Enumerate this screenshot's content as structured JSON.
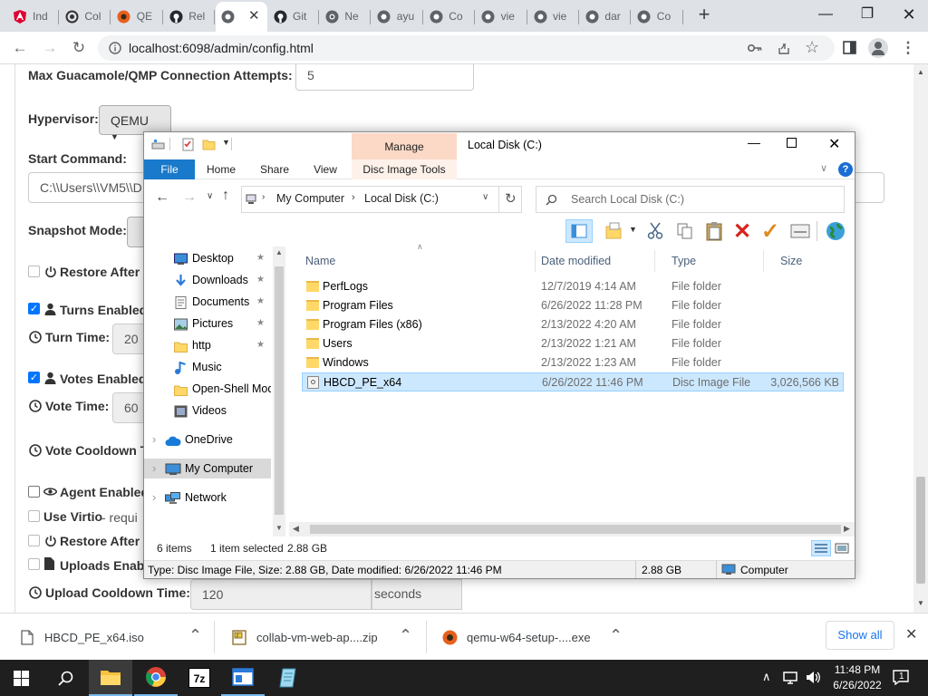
{
  "browser": {
    "tabs": [
      {
        "label": "Ind",
        "icon": "angular-icon",
        "color": "#dd0031"
      },
      {
        "label": "Col",
        "icon": "collabvm-icon",
        "color": "#333333"
      },
      {
        "label": "QE",
        "icon": "qemu-icon",
        "color": "#e8601c"
      },
      {
        "label": "Rel",
        "icon": "github-icon",
        "color": "#24292e"
      },
      {
        "label": "",
        "icon": "globe-icon",
        "color": "#5f6368",
        "active": true
      },
      {
        "label": "Git",
        "icon": "github-icon",
        "color": "#24292e"
      },
      {
        "label": "Ne",
        "icon": "chrome-icon",
        "color": "#5f6368"
      },
      {
        "label": "ayu",
        "icon": "globe-icon",
        "color": "#5f6368"
      },
      {
        "label": "Co",
        "icon": "globe-icon",
        "color": "#5f6368"
      },
      {
        "label": "vie",
        "icon": "globe-icon",
        "color": "#5f6368"
      },
      {
        "label": "vie",
        "icon": "globe-icon",
        "color": "#5f6368"
      },
      {
        "label": "dar",
        "icon": "globe-icon",
        "color": "#5f6368"
      },
      {
        "label": "Co",
        "icon": "globe-icon",
        "color": "#5f6368"
      }
    ],
    "url": "localhost:6098/admin/config.html"
  },
  "config": {
    "max_attempts_label": "Max Guacamole/QMP Connection Attempts:",
    "max_attempts_value": "5",
    "hypervisor_label": "Hypervisor:",
    "hypervisor_value": "QEMU",
    "start_command_label": "Start Command:",
    "start_command_value": "C:\\\\Users\\\\VM5\\\\D",
    "snapshot_label": "Snapshot Mode:",
    "restore_after_label": "Restore After",
    "turns_label": "Turns Enabled",
    "turn_time_label": "Turn Time:",
    "turn_time_value": "20",
    "votes_label": "Votes Enabled",
    "vote_time_label": "Vote Time:",
    "vote_time_value": "60",
    "vote_cooldown_label": "Vote Cooldown T",
    "agent_label": "Agent Enabled",
    "virtio_label": "Use Virtio",
    "virtio_note": " - requi",
    "restore_after2_label": "Restore After",
    "uploads_label": "Uploads Enab",
    "upload_cooldown_label": "Upload Cooldown Time:",
    "upload_cooldown_value": "120",
    "upload_cooldown_unit": "seconds"
  },
  "explorer": {
    "title": "Local Disk (C:)",
    "manage_tab": "Manage",
    "ribbon": {
      "file": "File",
      "home": "Home",
      "share": "Share",
      "view": "View",
      "disc_tools": "Disc Image Tools"
    },
    "breadcrumb": [
      "My Computer",
      "Local Disk (C:)"
    ],
    "search_placeholder": "Search Local Disk (C:)",
    "nav": [
      {
        "label": "Desktop",
        "icon": "desktop-icon",
        "pinned": true
      },
      {
        "label": "Downloads",
        "icon": "downloads-icon",
        "pinned": true
      },
      {
        "label": "Documents",
        "icon": "documents-icon",
        "pinned": true
      },
      {
        "label": "Pictures",
        "icon": "pictures-icon",
        "pinned": true
      },
      {
        "label": "http",
        "icon": "folder-icon",
        "pinned": true
      },
      {
        "label": "Music",
        "icon": "music-icon",
        "pinned": false
      },
      {
        "label": "Open-Shell Mod",
        "icon": "folder-icon",
        "pinned": false
      },
      {
        "label": "Videos",
        "icon": "videos-icon",
        "pinned": false
      },
      {
        "label": "OneDrive",
        "icon": "onedrive-icon",
        "pinned": false
      },
      {
        "label": "My Computer",
        "icon": "computer-icon",
        "pinned": false,
        "selected": true
      },
      {
        "label": "Network",
        "icon": "network-icon",
        "pinned": false
      }
    ],
    "columns": {
      "name": "Name",
      "date": "Date modified",
      "type": "Type",
      "size": "Size"
    },
    "files": [
      {
        "name": "PerfLogs",
        "date": "12/7/2019 4:14 AM",
        "type": "File folder",
        "size": ""
      },
      {
        "name": "Program Files",
        "date": "6/26/2022 11:28 PM",
        "type": "File folder",
        "size": ""
      },
      {
        "name": "Program Files (x86)",
        "date": "2/13/2022 4:20 AM",
        "type": "File folder",
        "size": ""
      },
      {
        "name": "Users",
        "date": "2/13/2022 1:21 AM",
        "type": "File folder",
        "size": ""
      },
      {
        "name": "Windows",
        "date": "2/13/2022 1:23 AM",
        "type": "File folder",
        "size": ""
      },
      {
        "name": "HBCD_PE_x64",
        "date": "6/26/2022 11:46 PM",
        "type": "Disc Image File",
        "size": "3,026,566 KB",
        "selected": true
      }
    ],
    "item_count": "6 items",
    "selected_count": "1 item selected",
    "selected_size": "2.88 GB",
    "status_detail": "Type: Disc Image File, Size: 2.88 GB, Date modified: 6/26/2022 11:46 PM",
    "status_size": "2.88 GB",
    "status_location": "Computer"
  },
  "downloads": {
    "items": [
      {
        "name": "HBCD_PE_x64.iso",
        "icon": "file-icon"
      },
      {
        "name": "collab-vm-web-ap....zip",
        "icon": "zip-icon"
      },
      {
        "name": "qemu-w64-setup-....exe",
        "icon": "qemu-icon"
      }
    ],
    "show_all": "Show all"
  },
  "taskbar": {
    "time": "11:48 PM",
    "date": "6/26/2022",
    "notifications": "1"
  }
}
